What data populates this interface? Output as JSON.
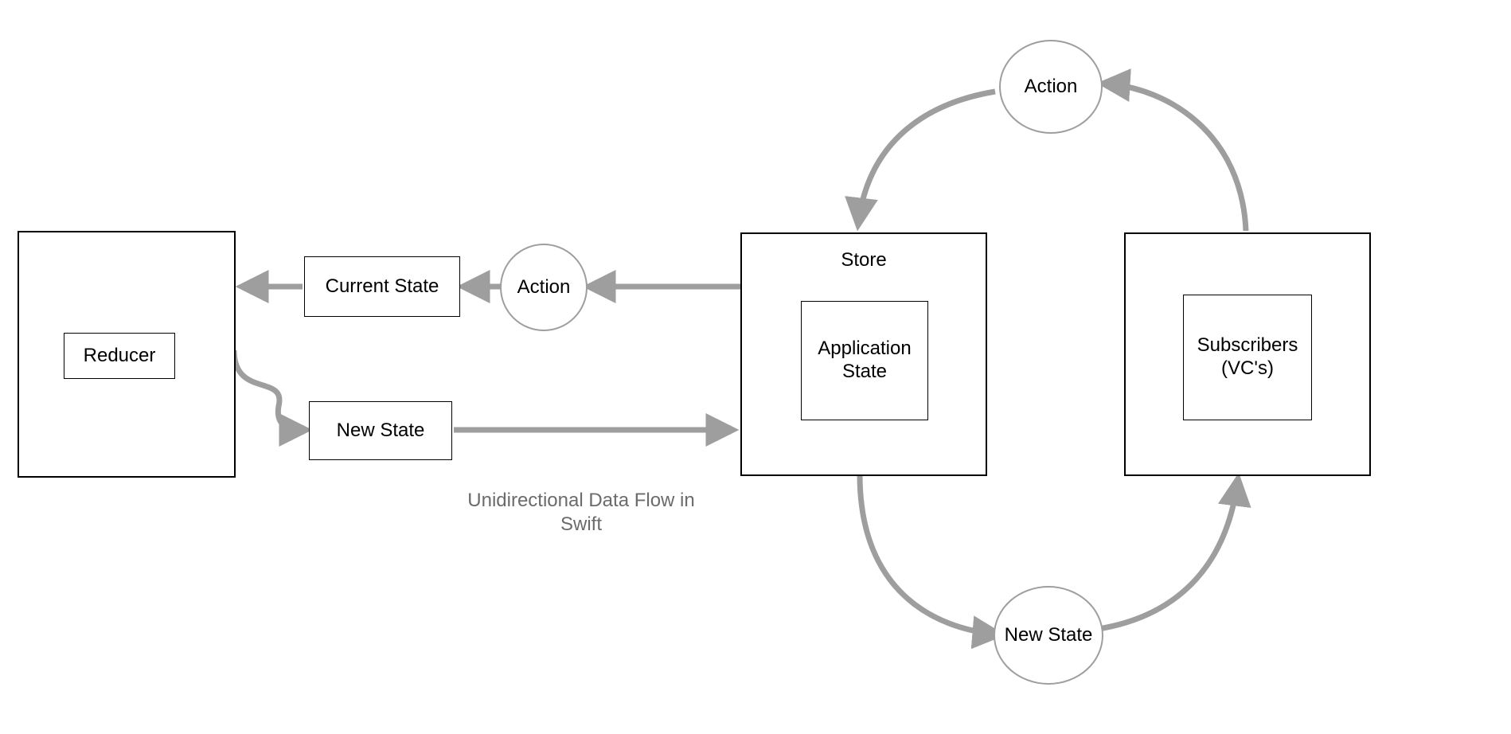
{
  "title": "Unidirectional Data Flow in Swift",
  "colors": {
    "arrow": "#9e9e9e",
    "boxBorder": "#000000",
    "circleBorder": "#9e9e9e",
    "captionText": "#6b6b6b"
  },
  "nodes": {
    "reducerOuter": {
      "label": ""
    },
    "reducerInner": {
      "label": "Reducer"
    },
    "currentState": {
      "label": "Current State"
    },
    "newStateLeft": {
      "label": "New State"
    },
    "actionLeft": {
      "label": "Action"
    },
    "storeOuter": {
      "label": "Store"
    },
    "storeInner": {
      "label": "Application State"
    },
    "subscribersOuter": {
      "label": ""
    },
    "subscribersInner": {
      "label": "Subscribers (VC's)"
    },
    "actionTop": {
      "label": "Action"
    },
    "newStateBottom": {
      "label": "New State"
    }
  },
  "caption": "Unidirectional Data Flow in Swift"
}
